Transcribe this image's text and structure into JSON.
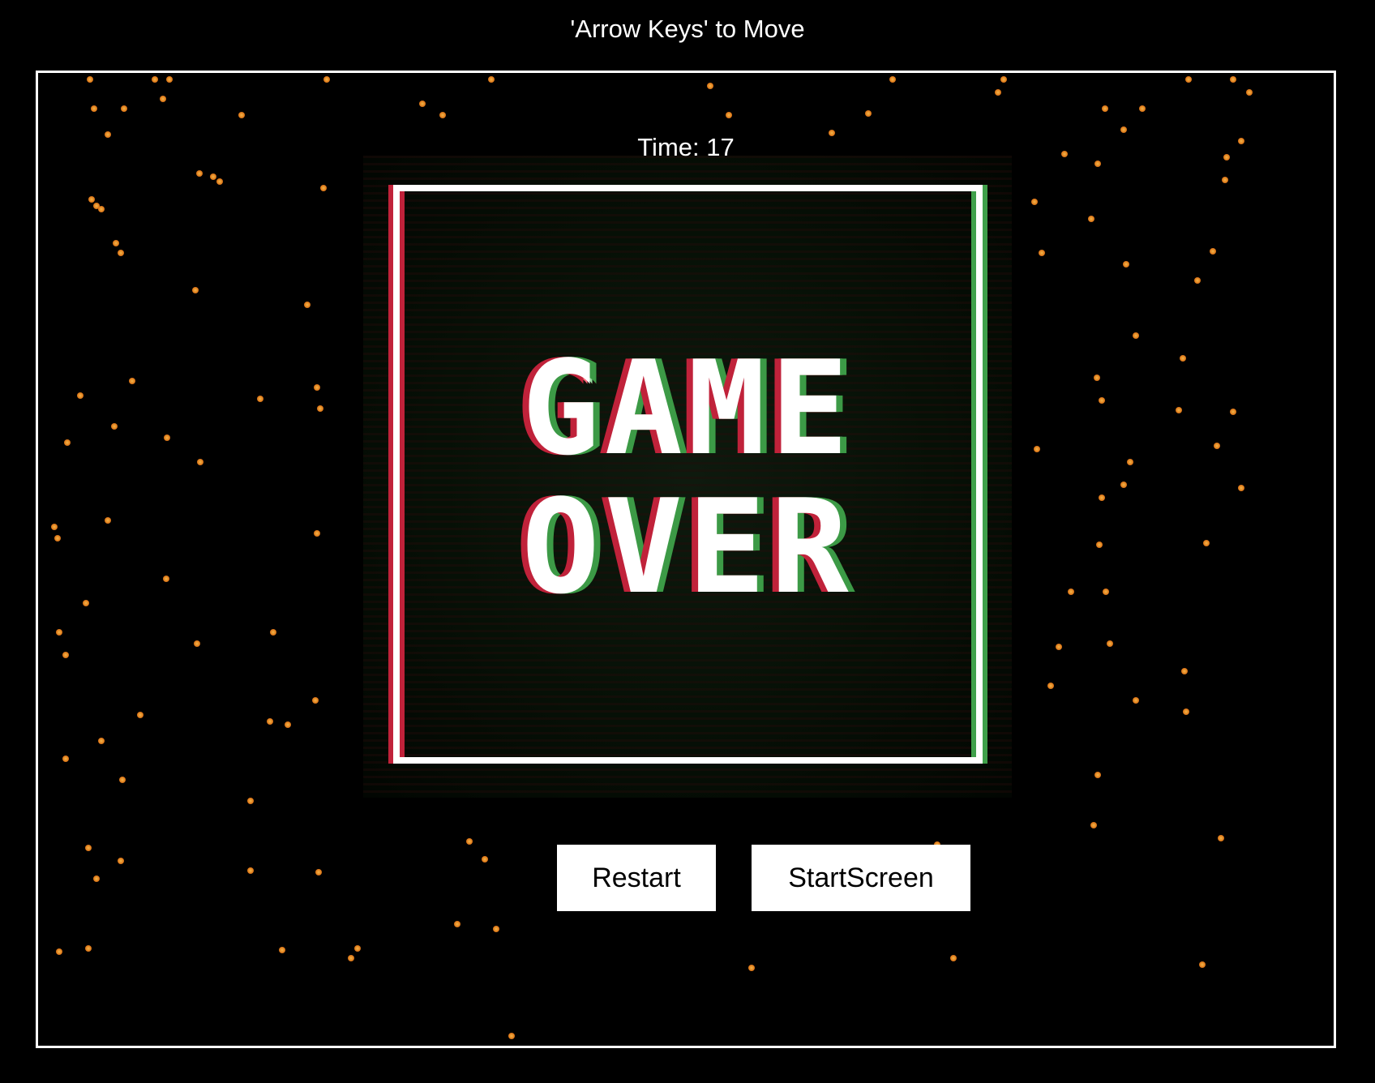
{
  "header": {
    "instructions": "'Arrow Keys' to Move"
  },
  "game": {
    "timer_text": "Time: 17",
    "game_over_line1": "GAME",
    "game_over_line2": "OVER",
    "star_color": "#e07a1a",
    "border_color": "#ffffff",
    "glitch_red": "#c0223a",
    "glitch_green": "#3fa04a"
  },
  "buttons": {
    "restart_label": "Restart",
    "startscreen_label": "StartScreen"
  }
}
